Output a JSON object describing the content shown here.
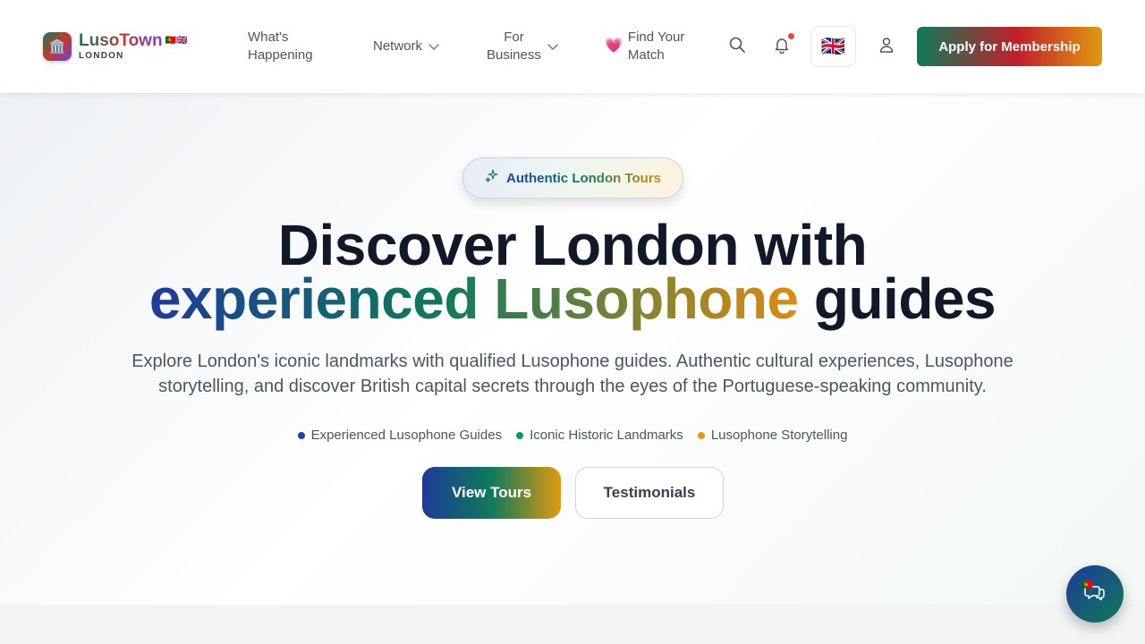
{
  "brand": {
    "logo_emoji": "🏛️",
    "name": "LusoTown",
    "flags": "🇵🇹🇬🇧",
    "subtitle": "LONDON"
  },
  "nav": {
    "whats_happening_line1": "What's",
    "whats_happening_line2": "Happening",
    "network": "Network",
    "for_business_line1": "For",
    "for_business_line2": "Business",
    "find_match_emoji": "💗",
    "find_match_line1": "Find Your",
    "find_match_line2": "Match"
  },
  "header_actions": {
    "search_icon": "search-icon",
    "notifications_icon": "bell-icon",
    "language_flag": "🇬🇧",
    "user_icon": "user-icon",
    "apply_label": "Apply for Membership"
  },
  "hero": {
    "badge_label": "Authentic London Tours",
    "title_line1": "Discover London with",
    "title_highlight": "experienced Lusophone",
    "title_end": " guides",
    "lead": "Explore London's iconic landmarks with qualified Lusophone guides. Authentic cultural experiences, Lusophone storytelling, and discover British capital secrets through the eyes of the Portuguese-speaking community.",
    "features": [
      {
        "label": "Experienced Lusophone Guides",
        "color": "#1e40af"
      },
      {
        "label": "Iconic Historic Landmarks",
        "color": "#059669"
      },
      {
        "label": "Lusophone Storytelling",
        "color": "#e09a10"
      }
    ],
    "primary_cta": "View Tours",
    "secondary_cta": "Testimonials"
  },
  "chat": {
    "flag": "🇵🇹",
    "icon": "chat-icon"
  },
  "colors": {
    "accent_green": "#0f7a5a",
    "accent_red": "#c41e2a",
    "accent_gold": "#e09a10",
    "accent_blue": "#1e3a9a",
    "notification_dot": "#ef4444"
  }
}
